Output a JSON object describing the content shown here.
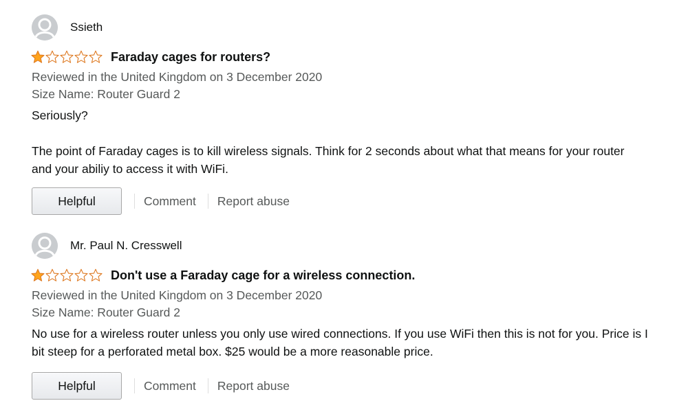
{
  "reviews": [
    {
      "author": "Ssieth",
      "rating": 1,
      "rating_max": 5,
      "title": "Faraday cages for routers?",
      "reviewed_line": "Reviewed in the United Kingdom on 3 December 2020",
      "size_line": "Size Name: Router Guard 2",
      "body_paragraphs": [
        "Seriously?",
        "The point of Faraday cages is to kill wireless signals. Think for 2 seconds about what that means for your router and your abiliy to access it with WiFi."
      ],
      "helpful_label": "Helpful",
      "comment_label": "Comment",
      "report_label": "Report abuse"
    },
    {
      "author": "Mr. Paul N. Cresswell",
      "rating": 1,
      "rating_max": 5,
      "title": "Don't use a Faraday cage for a wireless connection.",
      "reviewed_line": "Reviewed in the United Kingdom on 3 December 2020",
      "size_line": "Size Name: Router Guard 2",
      "body_paragraphs": [
        "No use for a wireless router unless you only use wired connections. If you use WiFi then this is not for you. Price is I bit steep for a perforated metal box. $25 would be a more reasonable price."
      ],
      "helpful_label": "Helpful",
      "comment_label": "Comment",
      "report_label": "Report abuse"
    }
  ],
  "icons": {
    "avatar": "default-user-avatar-icon",
    "star_filled": "star-filled-icon",
    "star_empty": "star-outline-icon"
  },
  "colors": {
    "star": "#ffa41c",
    "star_outline": "#de7921",
    "secondary_text": "#565959",
    "avatar_bg": "#c9cccf"
  }
}
